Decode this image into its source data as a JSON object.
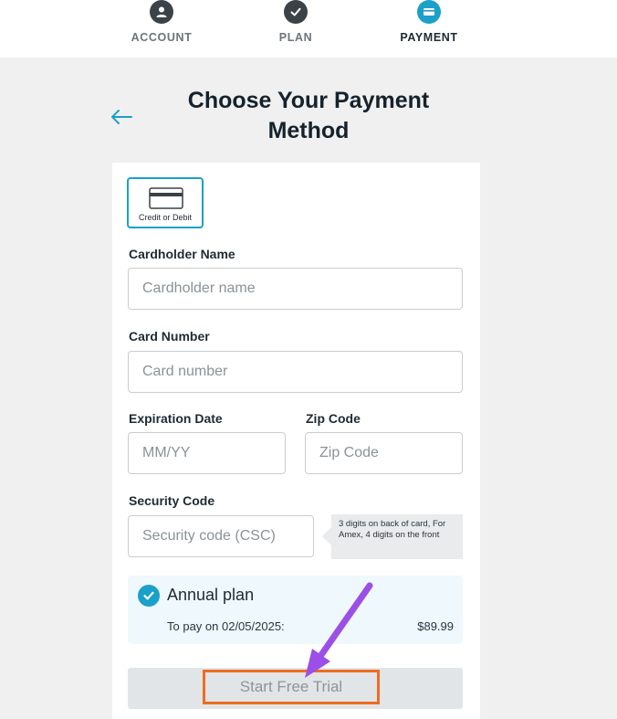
{
  "stepper": {
    "steps": [
      {
        "label": "ACCOUNT",
        "icon": "user-icon",
        "state": "done"
      },
      {
        "label": "PLAN",
        "icon": "check-icon",
        "state": "done"
      },
      {
        "label": "PAYMENT",
        "icon": "card-icon",
        "state": "active"
      }
    ]
  },
  "header": {
    "back_icon": "back-arrow-icon",
    "title": "Choose Your Payment Method"
  },
  "payment_methods": [
    {
      "label": "Credit or Debit",
      "icon": "credit-card-icon",
      "selected": true
    }
  ],
  "form": {
    "cardholder": {
      "label": "Cardholder Name",
      "placeholder": "Cardholder name",
      "value": ""
    },
    "card_number": {
      "label": "Card Number",
      "placeholder": "Card number",
      "value": ""
    },
    "expiration": {
      "label": "Expiration Date",
      "placeholder": "MM/YY",
      "value": ""
    },
    "zip": {
      "label": "Zip Code",
      "placeholder": "Zip Code",
      "value": ""
    },
    "security": {
      "label": "Security Code",
      "placeholder": "Security code (CSC)",
      "value": "",
      "hint": "3 digits on back of card, For Amex, 4 digits on the front"
    }
  },
  "plan": {
    "name": "Annual plan",
    "pay_date_text": "To pay on 02/05/2025:",
    "price": "$89.99",
    "checked": true
  },
  "cta": {
    "label": "Start Free Trial",
    "highlight_color": "#ee6c20"
  },
  "annotation": {
    "arrow_color": "#9b4fe8"
  },
  "colors": {
    "accent": "#1ba0c9",
    "background": "#f0f0f0",
    "done_step": "#3c4348"
  }
}
